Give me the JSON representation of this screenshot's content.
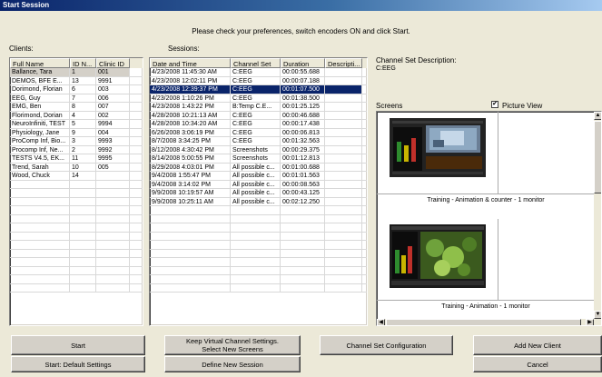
{
  "window": {
    "title": "Start Session"
  },
  "instructions": "Please check your preferences, switch encoders ON and click Start.",
  "clients": {
    "label": "Clients:",
    "columns": [
      "Full Name",
      "ID N...",
      "Clinic ID"
    ],
    "rows": [
      [
        "Ballance, Tara",
        "1",
        "001"
      ],
      [
        "DEMOS, BFE E...",
        "13",
        "9991"
      ],
      [
        "Dorimond, Florian",
        "6",
        "003"
      ],
      [
        "EEG, Guy",
        "7",
        "006"
      ],
      [
        "EMG, Ben",
        "8",
        "007"
      ],
      [
        "Florimond, Dorian",
        "4",
        "002"
      ],
      [
        "NeuroInfiniti, TEST",
        "5",
        "9994"
      ],
      [
        "Physiology, Jane",
        "9",
        "004"
      ],
      [
        "ProComp Inf, Bio...",
        "3",
        "9993"
      ],
      [
        "Procomp Inf, Ne...",
        "2",
        "9992"
      ],
      [
        "TESTS V4.5, EK...",
        "11",
        "9995"
      ],
      [
        "Trend, Sarah",
        "10",
        "005"
      ],
      [
        "Wood, Chuck",
        "14",
        ""
      ]
    ]
  },
  "sessions": {
    "label": "Sessions:",
    "columns": [
      "Date and Time",
      "Channel Set",
      "Duration",
      "Descripti..."
    ],
    "rows": [
      [
        "4/23/2008 11:45:30 AM",
        "C:EEG",
        "00:00:55.688",
        ""
      ],
      [
        "4/23/2008 12:02:11 PM",
        "C:EEG",
        "00:00:07.188",
        ""
      ],
      [
        "4/23/2008 12:39:37 PM",
        "C:EEG",
        "00:01:07.500",
        ""
      ],
      [
        "4/23/2008 1:10:26 PM",
        "C:EEG",
        "00:01:38.500",
        ""
      ],
      [
        "4/23/2008 1:43:22 PM",
        "B:Temp C.E...",
        "00:01:25.125",
        ""
      ],
      [
        "4/28/2008 10:21:13 AM",
        "C:EEG",
        "00:00:46.688",
        ""
      ],
      [
        "4/28/2008 10:34:20 AM",
        "C:EEG",
        "00:00:17.438",
        ""
      ],
      [
        "6/26/2008 3:06:19 PM",
        "C:EEG",
        "00:00:06.813",
        ""
      ],
      [
        "8/7/2008 3:34:25 PM",
        "C:EEG",
        "00:01:32.563",
        ""
      ],
      [
        "8/12/2008 4:30:42 PM",
        "Screenshots",
        "00:00:29.375",
        ""
      ],
      [
        "8/14/2008 5:00:55 PM",
        "Screenshots",
        "00:01:12.813",
        ""
      ],
      [
        "8/29/2008 4:03:01 PM",
        "All possible c...",
        "00:01:00.688",
        ""
      ],
      [
        "9/4/2008 1:55:47 PM",
        "All possible c...",
        "00:01:01.563",
        ""
      ],
      [
        "9/4/2008 3:14:02 PM",
        "All possible c...",
        "00:00:08.563",
        ""
      ],
      [
        "9/9/2008 10:19:57 AM",
        "All possible c...",
        "00:00:43.125",
        ""
      ],
      [
        "9/9/2008 10:25:11 AM",
        "All possible c...",
        "00:02:12.250",
        ""
      ]
    ]
  },
  "channel_set": {
    "label": "Channel Set Description:",
    "value": "C:EEG"
  },
  "screens": {
    "label": "Screens",
    "picture_view_label": "Picture View",
    "picture_view_checked": "✔",
    "items": [
      {
        "caption": "Training - Animation & counter - 1 monitor"
      },
      {
        "caption": "Training - Animation - 1 monitor"
      }
    ]
  },
  "buttons": {
    "start": "Start",
    "start_default": "Start: Default Settings",
    "keep_virtual_1": "Keep Virtual Channel Settings.",
    "keep_virtual_2": "Select New Screens",
    "define_new": "Define New Session",
    "channel_config": "Channel Set Configuration",
    "add_client": "Add New Client",
    "cancel": "Cancel"
  },
  "colors": {
    "selection": "#0a246a",
    "face": "#ece9d8"
  }
}
